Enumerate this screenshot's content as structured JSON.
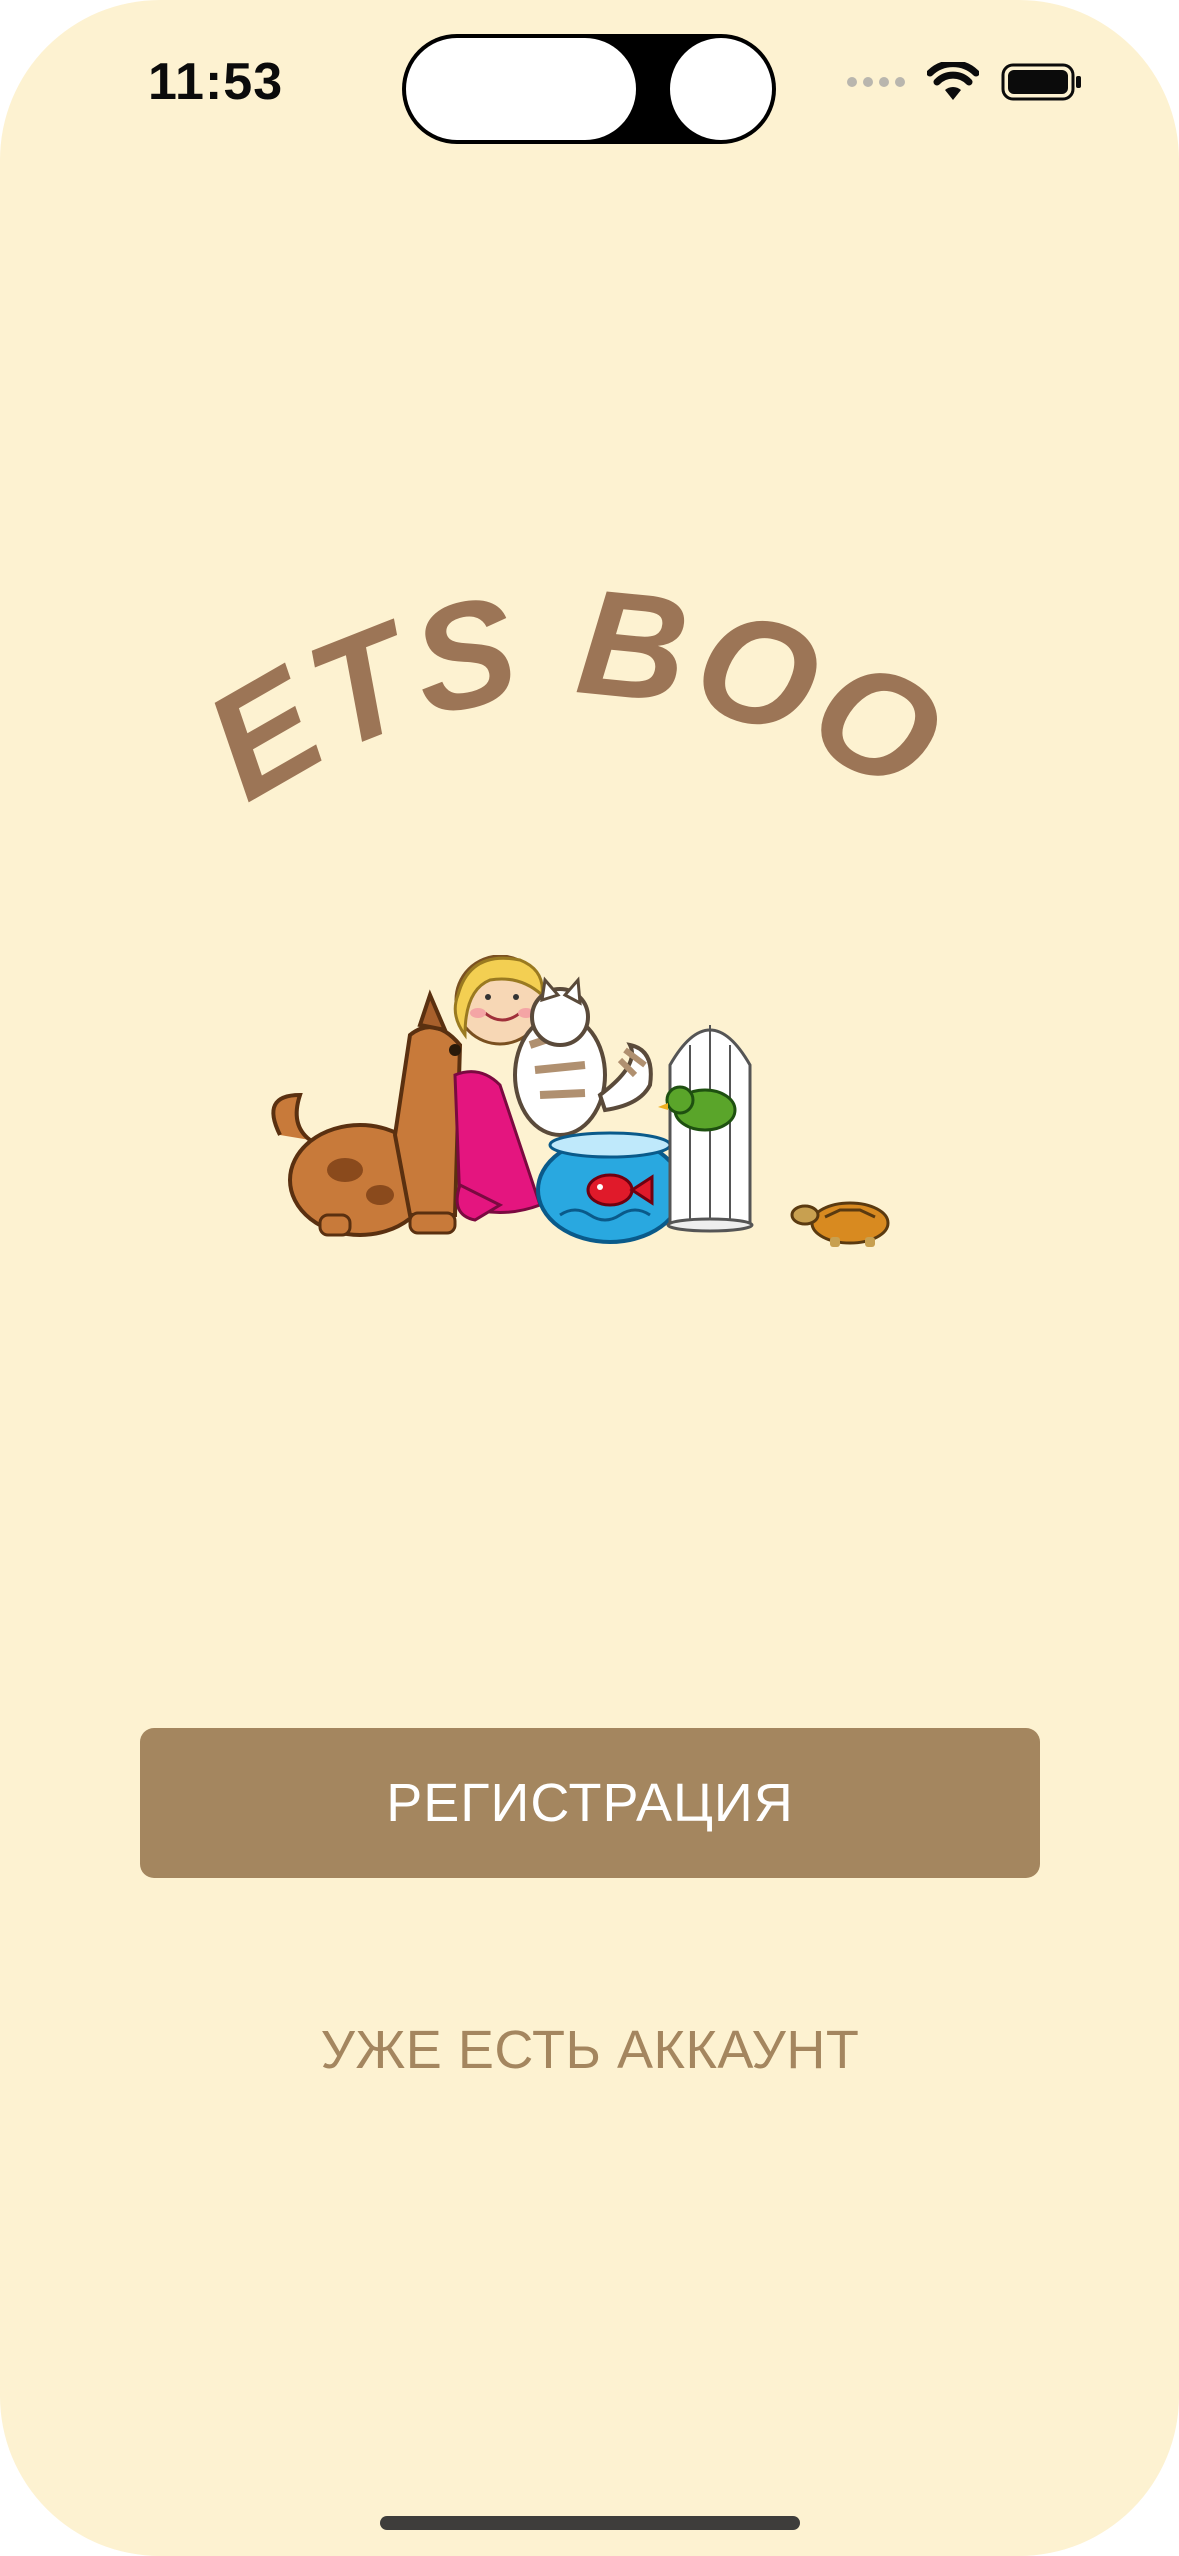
{
  "status_bar": {
    "time": "11:53",
    "icons": [
      "signal-dots-icon",
      "wifi-icon",
      "battery-icon"
    ]
  },
  "app": {
    "title": "PETS BOOK",
    "title_color": "#9c7556",
    "illustration": "girl-with-pets-illustration"
  },
  "actions": {
    "register_label": "РЕГИСТРАЦИЯ",
    "login_label": "УЖЕ ЕСТЬ АККАУНТ"
  },
  "colors": {
    "background": "#fdf2d1",
    "accent": "#a4865f"
  }
}
